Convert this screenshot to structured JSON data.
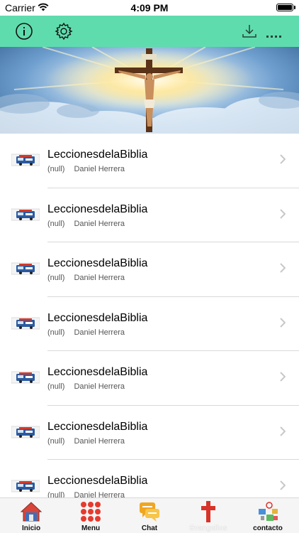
{
  "status_bar": {
    "carrier": "Carrier",
    "time": "4:09 PM"
  },
  "toolbar": {
    "info_icon": "info-circle-icon",
    "settings_icon": "gear-icon",
    "download_icon": "download-icon",
    "more_icon": "ellipsis-icon",
    "accent_color": "#5fdcae"
  },
  "banner": {
    "image": "crucifix-in-sky"
  },
  "list": {
    "items": [
      {
        "title": "LeccionesdelaBiblia",
        "category": "(null)",
        "author": "Daniel Herrera"
      },
      {
        "title": "LeccionesdelaBiblia",
        "category": "(null)",
        "author": "Daniel Herrera"
      },
      {
        "title": "LeccionesdelaBiblia",
        "category": "(null)",
        "author": "Daniel Herrera"
      },
      {
        "title": "LeccionesdelaBiblia",
        "category": "(null)",
        "author": "Daniel Herrera"
      },
      {
        "title": "LeccionesdelaBiblia",
        "category": "(null)",
        "author": "Daniel Herrera"
      },
      {
        "title": "LeccionesdelaBiblia",
        "category": "(null)",
        "author": "Daniel Herrera"
      },
      {
        "title": "LeccionesdelaBiblia",
        "category": "(null)",
        "author": "Daniel Herrera"
      }
    ]
  },
  "tabbar": {
    "tabs": [
      {
        "label": "Inicio",
        "icon": "house-icon"
      },
      {
        "label": "Menu",
        "icon": "grid-dots-icon"
      },
      {
        "label": "Chat",
        "icon": "chat-bubbles-icon"
      },
      {
        "label": "Evangelios",
        "icon": "cross-icon"
      },
      {
        "label": "contacto",
        "icon": "contact-icon"
      }
    ],
    "selected_index": 3
  }
}
